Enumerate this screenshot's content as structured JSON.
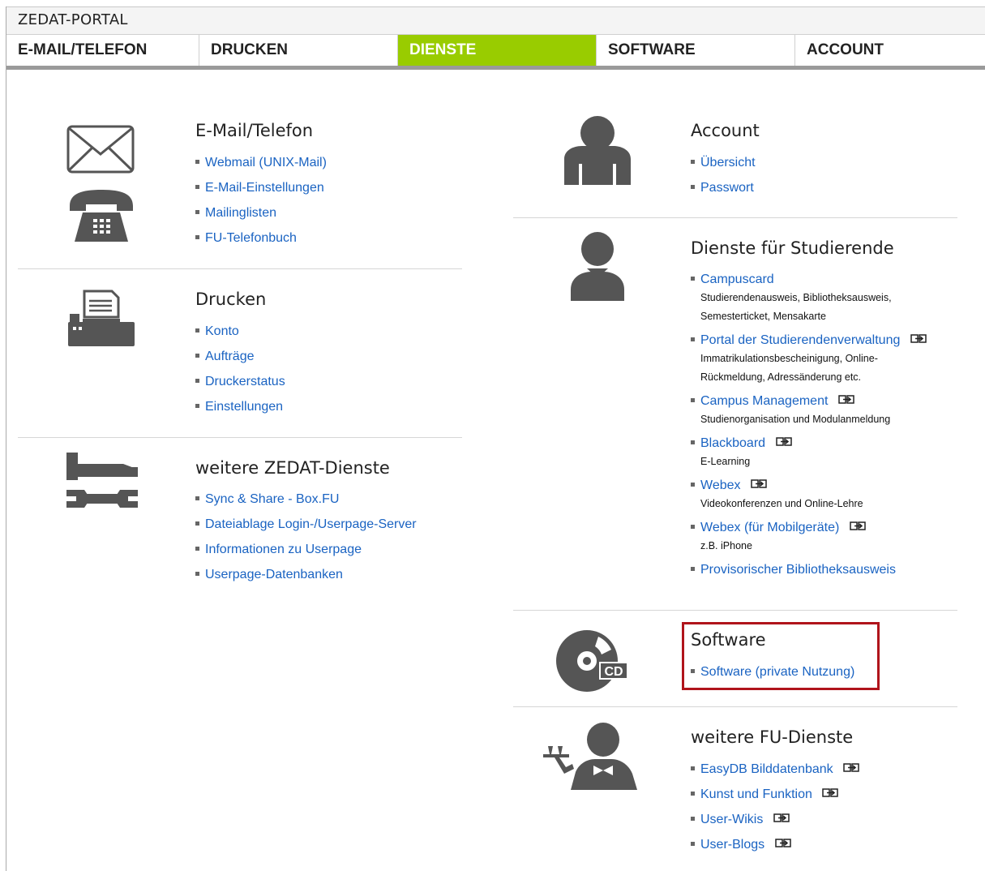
{
  "portal": {
    "title": "ZEDAT-PORTAL"
  },
  "nav": {
    "items": [
      {
        "label": "E-MAIL/TELEFON",
        "active": false
      },
      {
        "label": "DRUCKEN",
        "active": false
      },
      {
        "label": "DIENSTE",
        "active": true
      },
      {
        "label": "SOFTWARE",
        "active": false
      },
      {
        "label": "ACCOUNT",
        "active": false
      }
    ],
    "active_color": "#99cc00"
  },
  "left": {
    "email": {
      "title": "E-Mail/Telefon",
      "links": [
        "Webmail (UNIX-Mail)",
        "E-Mail-Einstellungen",
        "Mailinglisten",
        "FU-Telefonbuch"
      ]
    },
    "drucken": {
      "title": "Drucken",
      "links": [
        "Konto",
        "Aufträge",
        "Druckerstatus",
        "Einstellungen"
      ]
    },
    "zedat": {
      "title": "weitere ZEDAT-Dienste",
      "links": [
        "Sync & Share - Box.FU",
        "Dateiablage Login-/Userpage-Server",
        "Informationen zu Userpage",
        "Userpage-Datenbanken"
      ]
    }
  },
  "right": {
    "account": {
      "title": "Account",
      "links": [
        "Übersicht",
        "Passwort"
      ]
    },
    "studierende": {
      "title": "Dienste für Studierende",
      "items": [
        {
          "label": "Campuscard",
          "desc": "Studierendenausweis, Bibliotheksausweis, Semesterticket, Mensakarte",
          "external": false
        },
        {
          "label": "Portal der Studierendenverwaltung",
          "desc": "Immatrikulationsbescheinigung, Online-Rückmeldung, Adressänderung etc.",
          "external": true
        },
        {
          "label": "Campus Management",
          "desc": "Studienorganisation und Modulanmeldung",
          "external": true
        },
        {
          "label": "Blackboard",
          "desc": "E-Learning",
          "external": true
        },
        {
          "label": "Webex",
          "desc": "Videokonferenzen und Online-Lehre",
          "external": true
        },
        {
          "label": "Webex (für Mobilgeräte)",
          "desc": "z.B. iPhone",
          "external": true
        },
        {
          "label": "Provisorischer Bibliotheksausweis",
          "desc": "",
          "external": false
        }
      ]
    },
    "software": {
      "title": "Software",
      "links": [
        "Software (private Nutzung)"
      ],
      "icon_text": "CD",
      "highlight_color": "#b0141b"
    },
    "fu": {
      "title": "weitere FU-Dienste",
      "links": [
        "EasyDB Bilddatenbank",
        "Kunst und Funktion",
        "User-Wikis",
        "User-Blogs"
      ]
    }
  },
  "icons": {
    "email": "envelope-icon",
    "phone": "telephone-icon",
    "print": "fax-printer-icon",
    "tools": "hammer-wrench-icon",
    "account": "person-icon",
    "student": "student-person-icon",
    "software": "cd-icon",
    "fu": "waiter-icon",
    "external": "external-link-icon"
  }
}
